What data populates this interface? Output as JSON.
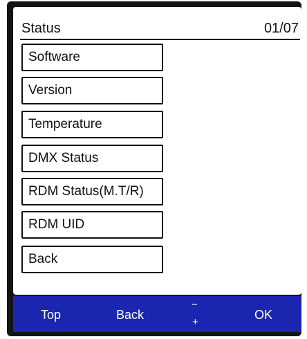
{
  "header": {
    "title": "Status",
    "page_indicator": "01/07"
  },
  "menu": {
    "items": [
      {
        "label": "Software"
      },
      {
        "label": "Version"
      },
      {
        "label": "Temperature"
      },
      {
        "label": "DMX Status"
      },
      {
        "label": "RDM Status(M.T/R)"
      },
      {
        "label": "RDM UID"
      },
      {
        "label": "Back"
      }
    ]
  },
  "softkeys": {
    "top": "Top",
    "back": "Back",
    "minus": "−",
    "plus": "+",
    "ok": "OK"
  },
  "colors": {
    "softkey_bar": "#1a25b0",
    "frame": "#141414",
    "screen": "#ffffff"
  }
}
